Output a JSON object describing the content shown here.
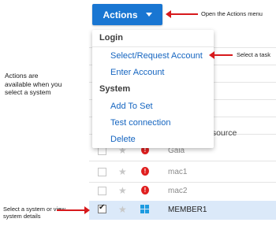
{
  "toolbar": {
    "actions_label": "Actions"
  },
  "menu": {
    "login_header": "Login",
    "login_items": [
      "Select/Request Account",
      "Enter Account"
    ],
    "system_header": "System",
    "system_items": [
      "Add To Set",
      "Test connection",
      "Delete"
    ]
  },
  "table": {
    "partial_text": "-resource",
    "rows": [
      {
        "name": "Gaia",
        "selected": false
      },
      {
        "name": "mac1",
        "selected": false
      },
      {
        "name": "mac2",
        "selected": false
      },
      {
        "name": "MEMBER1",
        "selected": true
      }
    ]
  },
  "annotations": {
    "open_menu": "Open the Actions menu",
    "select_task": "Select a task",
    "actions_available": "Actions are available when you select a system",
    "select_system": "Select a system or view system details"
  },
  "colors": {
    "accent": "#1976d2",
    "arrow": "#d7191c",
    "selected_row": "#dbe9f9",
    "alert": "#e01e1e"
  }
}
